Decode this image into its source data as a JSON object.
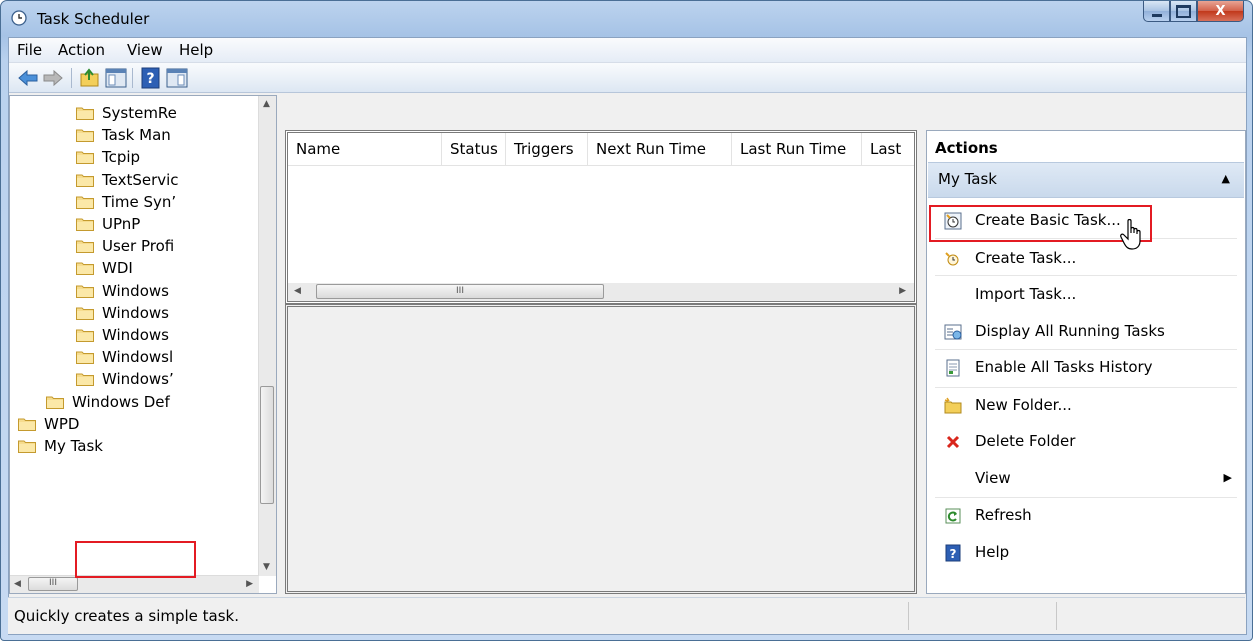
{
  "window": {
    "title": "Task Scheduler",
    "buttons": {
      "minimize": "—",
      "maximize": "☐",
      "close": "X"
    }
  },
  "menu": [
    "File",
    "Action",
    "View",
    "Help"
  ],
  "toolbar": {
    "icons": [
      "back-arrow-icon",
      "forward-arrow-icon",
      "folder-up-icon",
      "show-hide-console-tree-icon",
      "help-icon",
      "show-hide-action-pane-icon"
    ]
  },
  "tree": {
    "items": [
      {
        "label": "SystemRe",
        "indent": 2
      },
      {
        "label": "Task Man",
        "indent": 2
      },
      {
        "label": "Tcpip",
        "indent": 2
      },
      {
        "label": "TextServic",
        "indent": 2
      },
      {
        "label": "Time Syn’",
        "indent": 2
      },
      {
        "label": "UPnP",
        "indent": 2
      },
      {
        "label": "User Profi",
        "indent": 2
      },
      {
        "label": "WDI",
        "indent": 2
      },
      {
        "label": "Windows",
        "indent": 2
      },
      {
        "label": "Windows",
        "indent": 2
      },
      {
        "label": "Windows",
        "indent": 2
      },
      {
        "label": "Windowsl",
        "indent": 2
      },
      {
        "label": "Windows’",
        "indent": 2
      },
      {
        "label": "Windows Def",
        "indent": 1
      },
      {
        "label": "WPD",
        "indent": 0
      },
      {
        "label": "My Task",
        "indent": 0,
        "selected": true
      }
    ]
  },
  "task_list": {
    "columns": [
      "Name",
      "Status",
      "Triggers",
      "Next Run Time",
      "Last Run Time",
      "Last"
    ],
    "hscroll_grip": "III"
  },
  "tree_hscroll_grip": "III",
  "actions": {
    "title": "Actions",
    "section": "My Task",
    "items": [
      {
        "label": "Create Basic Task...",
        "icon": "create-basic-task-icon"
      },
      {
        "label": "Create Task...",
        "icon": "create-task-icon"
      },
      {
        "label": "Import Task...",
        "icon": ""
      },
      {
        "label": "Display All Running Tasks",
        "icon": "display-running-tasks-icon"
      },
      {
        "label": "Enable All Tasks History",
        "icon": "tasks-history-icon"
      },
      {
        "label": "New Folder...",
        "icon": "new-folder-icon"
      },
      {
        "label": "Delete Folder",
        "icon": "delete-icon"
      },
      {
        "label": "View",
        "icon": "",
        "submenu": true
      },
      {
        "label": "Refresh",
        "icon": "refresh-icon"
      },
      {
        "label": "Help",
        "icon": "help-icon"
      }
    ]
  },
  "status_bar": {
    "text": "Quickly creates a simple task."
  },
  "colors": {
    "highlight": "#e31b23",
    "selection_band": "#c9d9ec"
  }
}
